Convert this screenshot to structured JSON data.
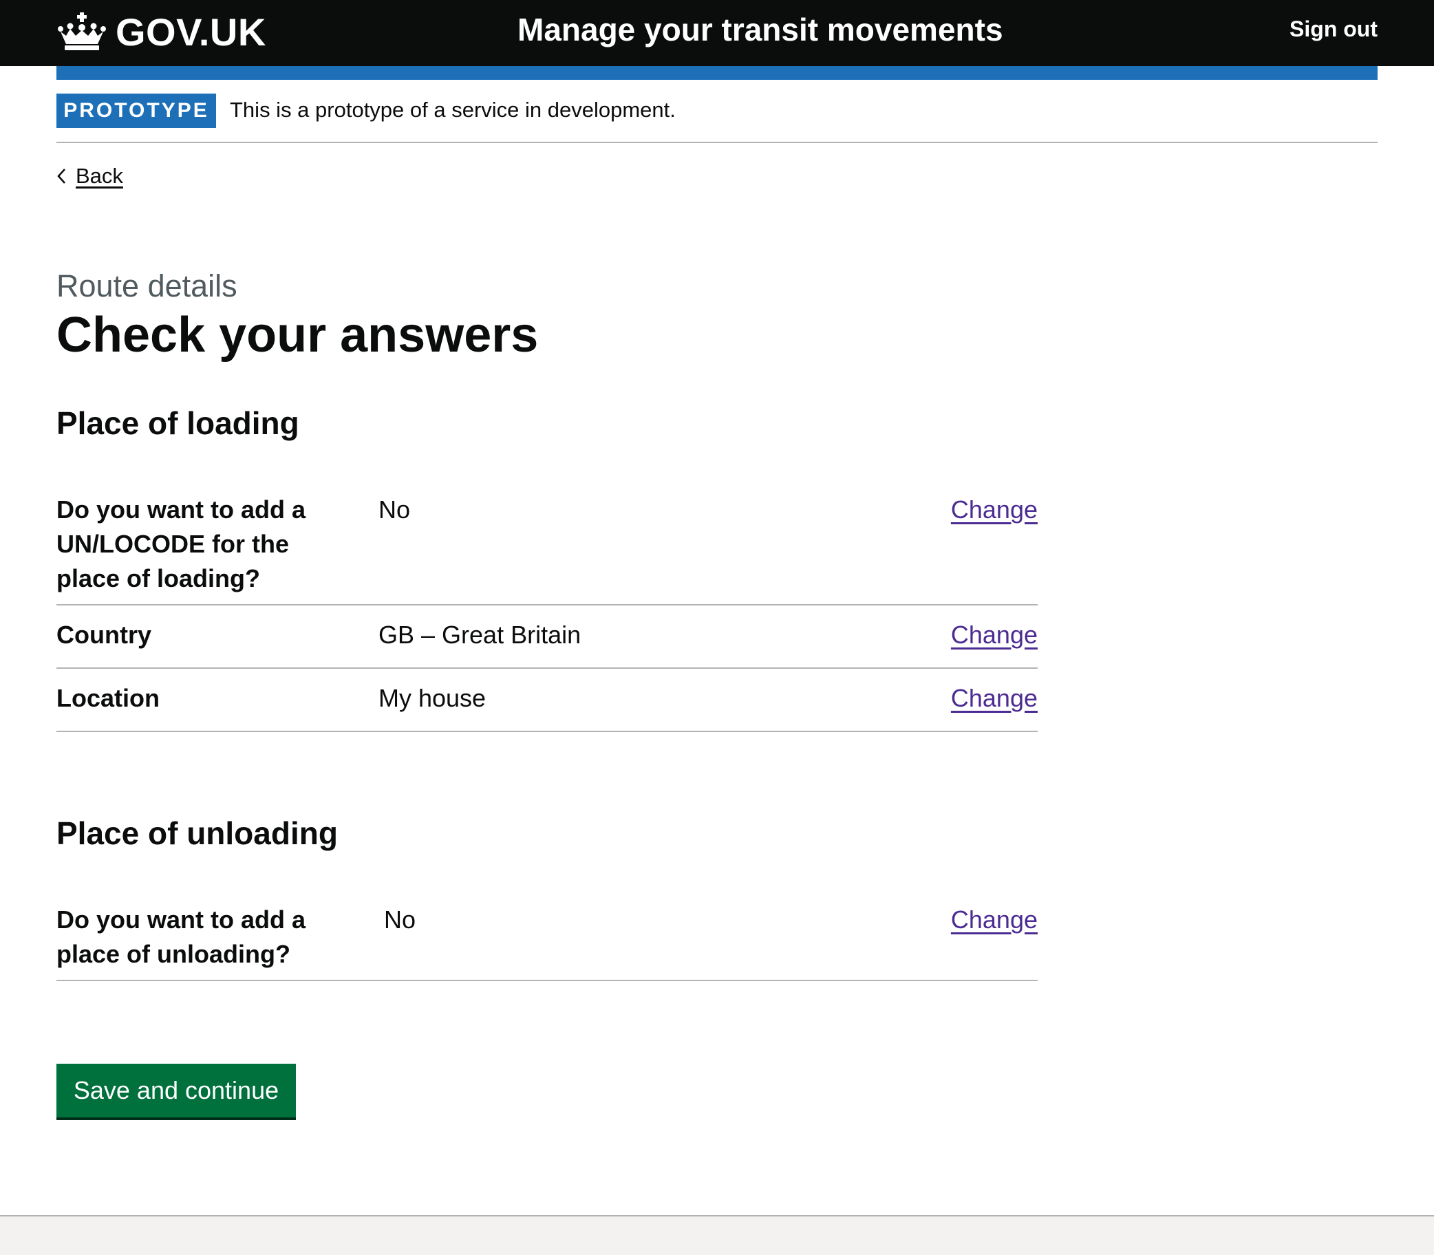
{
  "header": {
    "logo_text": "GOV.UK",
    "service_name": "Manage your transit movements",
    "sign_out_label": "Sign out"
  },
  "phase_banner": {
    "tag": "PROTOTYPE",
    "text": "This is a prototype of a service in development."
  },
  "back_link": {
    "label": "Back"
  },
  "caption": "Route details",
  "title": "Check your answers",
  "sections": [
    {
      "heading": "Place of loading",
      "rows": [
        {
          "key": "Do you want to add a UN/LOCODE for the place of loading?",
          "value": "No",
          "action": "Change"
        },
        {
          "key": "Country",
          "value": "GB – Great Britain",
          "action": "Change"
        },
        {
          "key": "Location",
          "value": "My house",
          "action": "Change"
        }
      ]
    },
    {
      "heading": "Place of unloading",
      "rows": [
        {
          "key": "Do you want to add a place of unloading?",
          "value": "No",
          "action": "Change"
        }
      ]
    }
  ],
  "submit_label": "Save and continue",
  "colors": {
    "header_background": "#0b0c0c",
    "header_bar": "#1d70b8",
    "phase_tag": "#1d70b8",
    "link_visited": "#4c2c92",
    "button_green": "#00703c",
    "footer_background": "#f3f2f1"
  },
  "icons": {
    "logo": "crown-icon",
    "back": "back-chevron-icon"
  }
}
